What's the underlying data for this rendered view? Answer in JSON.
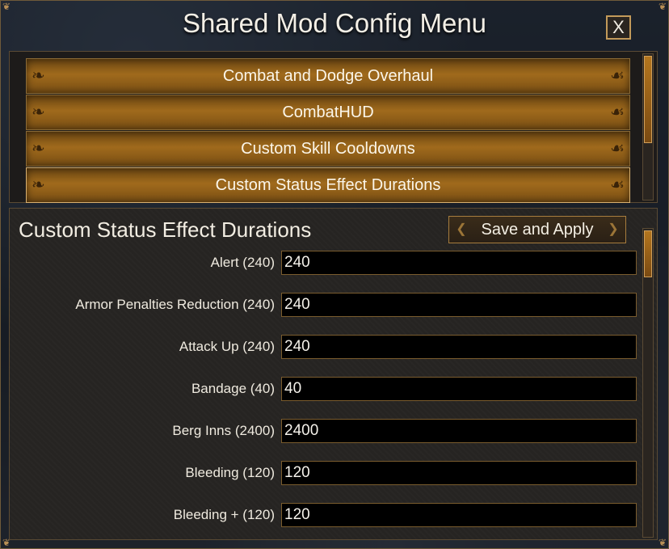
{
  "window": {
    "title": "Shared Mod Config Menu",
    "close_label": "X"
  },
  "mod_list": {
    "items": [
      {
        "label": "Combat and Dodge Overhaul"
      },
      {
        "label": "CombatHUD"
      },
      {
        "label": "Custom Skill Cooldowns"
      },
      {
        "label": "Custom Status Effect Durations"
      }
    ],
    "selected": "Custom Status Effect Durations"
  },
  "settings": {
    "title": "Custom Status Effect Durations",
    "save_label": "Save and Apply",
    "rows": [
      {
        "label": "Alert (240)",
        "value": "240"
      },
      {
        "label": "Armor Penalties Reduction (240)",
        "value": "240"
      },
      {
        "label": "Attack Up (240)",
        "value": "240"
      },
      {
        "label": "Bandage (40)",
        "value": "40"
      },
      {
        "label": "Berg Inns (2400)",
        "value": "2400"
      },
      {
        "label": "Bleeding (120)",
        "value": "120"
      },
      {
        "label": "Bleeding + (120)",
        "value": "120"
      }
    ]
  },
  "colors": {
    "accent_gold": "#c29a5a",
    "button_amber": "#a06a1c",
    "panel_dark": "#262422",
    "field_bg": "#000000",
    "text_light": "#f3efe6"
  },
  "icons": {
    "close": "close-icon",
    "ornament": "scroll-ornament-icon",
    "corner": "corner-ornament-icon"
  }
}
